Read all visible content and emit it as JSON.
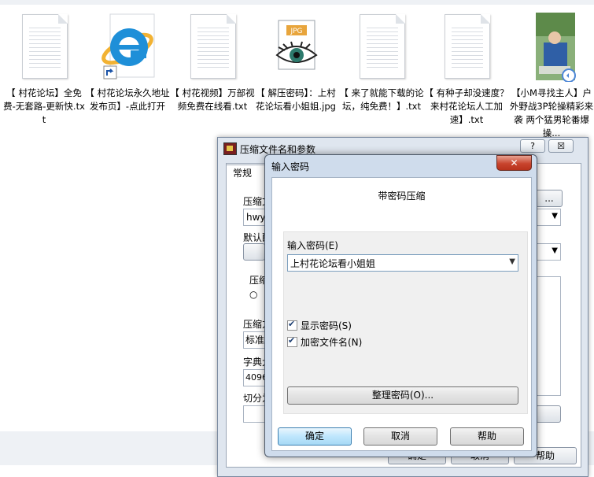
{
  "desktop": {
    "files": [
      {
        "label": "【 村花论坛】全免费-无套路-更新快.txt",
        "icon": "text-file-icon"
      },
      {
        "label": "【 村花论坛永久地址发布页】-点此打开",
        "icon": "ie-shortcut-icon"
      },
      {
        "label": "【 村花视频】万部视频免费在线看.txt",
        "icon": "text-file-icon"
      },
      {
        "label": "【 解压密码】：上村花论坛看小姐姐.jpg",
        "icon": "jpg-eye-icon",
        "badge": "JPG"
      },
      {
        "label": "【 来了就能下载的论坛，纯免费！】.txt",
        "icon": "text-file-icon"
      },
      {
        "label": "【 有种子却没速度？来村花论坛人工加速】.txt",
        "icon": "text-file-icon"
      },
      {
        "label": "【小M寻找主人】户外野战3P轮操精彩来袭 两个猛男轮番爆操...",
        "icon": "video-thumbnail-icon"
      }
    ]
  },
  "back_window": {
    "title": "压缩文件名和参数",
    "help_btn": "?",
    "close_btn": "☒",
    "tab": "常规",
    "labels": {
      "archive_name": "压缩文",
      "archive_value": "hwyz",
      "default": "默认配",
      "compress": "压缩",
      "method": "压缩方",
      "method_value": "标准",
      "dict": "字典大",
      "dict_value": "4096",
      "split": "切分为"
    },
    "browse": "...",
    "bottom_buttons": {
      "ok": "确定",
      "cancel": "取消",
      "help": "帮助"
    }
  },
  "dialog": {
    "title": "输入密码",
    "close": "✕",
    "header": "带密码压缩",
    "password_label": "输入密码(E)",
    "password_value": "上村花论坛看小姐姐",
    "show_password": "显示密码(S)",
    "encrypt_names": "加密文件名(N)",
    "organize": "整理密码(O)...",
    "ok": "确定",
    "cancel": "取消",
    "help": "帮助"
  },
  "colors": {
    "dialog_frame": "#cfdcec",
    "close_button": "#c8442d",
    "default_button": "#bee6fd"
  }
}
